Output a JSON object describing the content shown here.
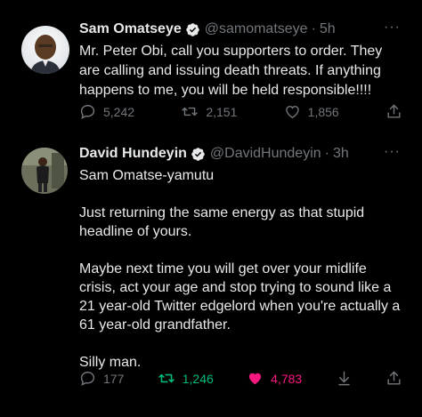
{
  "tweets": [
    {
      "author": {
        "name": "Sam Omatseye",
        "handle": "@samomatseye",
        "verified": true
      },
      "separator": "·",
      "time": "5h",
      "more": "···",
      "text": "Mr. Peter Obi, call you supporters to order. They\nare calling and issuing death threats. If anything\nhappens to me, you will be held responsible!!!!",
      "stats": {
        "replies": "5,242",
        "retweets": "2,151",
        "likes": "1,856"
      }
    },
    {
      "author": {
        "name": "David Hundeyin",
        "handle": "@DavidHundeyin",
        "verified": true
      },
      "separator": "·",
      "time": "3h",
      "more": "···",
      "text": "Sam Omatse-yamutu\n\nJust returning the same energy as that stupid\nheadline of yours.\n\nMaybe next time you will get over your midlife\ncrisis, act your age and stop trying to sound like a\n21 year-old Twitter edgelord when you're actually a\n61 year-old grandfather.\n\nSilly man.",
      "stats": {
        "replies": "177",
        "retweets": "1,246",
        "likes": "4,783"
      }
    }
  ],
  "colors": {
    "background": "#000000",
    "text": "#e7e9ea",
    "muted": "#71767b",
    "verified": "#1d9bf0",
    "retweet_active": "#00ba7c",
    "like_active": "#f91880"
  },
  "icons": {
    "verified": "verified-badge-icon",
    "reply": "reply-icon",
    "retweet": "retweet-icon",
    "like": "heart-icon",
    "share": "share-icon",
    "more": "more-icon"
  }
}
